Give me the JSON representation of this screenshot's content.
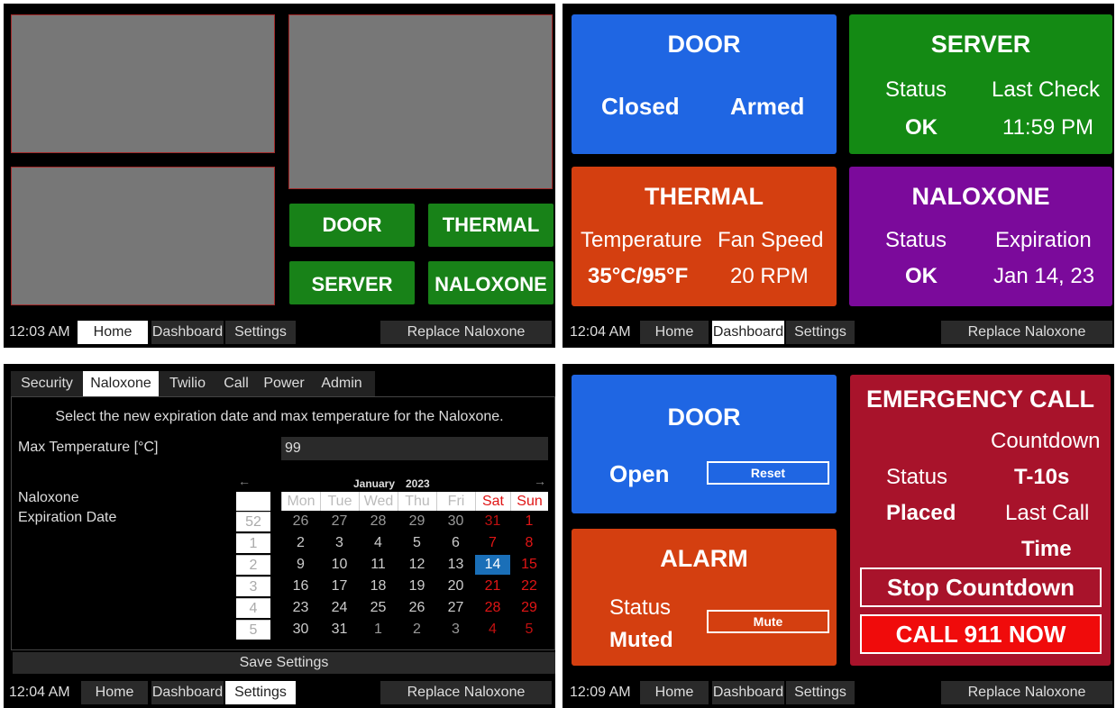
{
  "common": {
    "nav_home": "Home",
    "nav_dashboard": "Dashboard",
    "nav_settings": "Settings",
    "replace_naloxone": "Replace Naloxone"
  },
  "screens": {
    "home": {
      "time": "12:03 AM",
      "door_btn": "DOOR",
      "thermal_btn": "THERMAL",
      "server_btn": "SERVER",
      "naloxone_btn": "NALOXONE"
    },
    "dashboard": {
      "time": "12:04 AM",
      "door": {
        "title": "DOOR",
        "state": "Closed",
        "mode": "Armed"
      },
      "server": {
        "title": "SERVER",
        "status_label": "Status",
        "status_value": "OK",
        "check_label": "Last Check",
        "check_value": "11:59 PM"
      },
      "thermal": {
        "title": "THERMAL",
        "temp_label": "Temperature",
        "temp_value": "35°C/95°F",
        "fan_label": "Fan Speed",
        "fan_value": "20 RPM"
      },
      "naloxone": {
        "title": "NALOXONE",
        "status_label": "Status",
        "status_value": "OK",
        "exp_label": "Expiration",
        "exp_value": "Jan 14, 23"
      }
    },
    "settings": {
      "time": "12:04 AM",
      "tabs": [
        "Security",
        "Naloxone",
        "Twilio",
        "Call",
        "Power",
        "Admin"
      ],
      "instruction": "Select the new expiration date and max temperature for the Naloxone.",
      "max_temp_label": "Max Temperature [°C]",
      "max_temp_value": "99",
      "exp_label_line1": "Naloxone",
      "exp_label_line2": "Expiration Date",
      "calendar": {
        "prev": "←",
        "next": "→",
        "month": "January",
        "year": "2023",
        "weekdays": [
          "Mon",
          "Tue",
          "Wed",
          "Thu",
          "Fri",
          "Sat",
          "Sun"
        ],
        "weeks": [
          {
            "num": "52",
            "days": [
              "26",
              "27",
              "28",
              "29",
              "30",
              "31",
              "1"
            ]
          },
          {
            "num": "1",
            "days": [
              "2",
              "3",
              "4",
              "5",
              "6",
              "7",
              "8"
            ]
          },
          {
            "num": "2",
            "days": [
              "9",
              "10",
              "11",
              "12",
              "13",
              "14",
              "15"
            ]
          },
          {
            "num": "3",
            "days": [
              "16",
              "17",
              "18",
              "19",
              "20",
              "21",
              "22"
            ]
          },
          {
            "num": "4",
            "days": [
              "23",
              "24",
              "25",
              "26",
              "27",
              "28",
              "29"
            ]
          },
          {
            "num": "5",
            "days": [
              "30",
              "31",
              "1",
              "2",
              "3",
              "4",
              "5"
            ]
          }
        ],
        "selected_day": "14"
      },
      "save_button": "Save Settings"
    },
    "emergency": {
      "time": "12:09 AM",
      "door": {
        "title": "DOOR",
        "state": "Open",
        "reset_btn": "Reset"
      },
      "alarm": {
        "title": "ALARM",
        "status_label": "Status",
        "status_value": "Muted",
        "mute_btn": "Mute"
      },
      "call": {
        "title": "EMERGENCY CALL",
        "countdown_label": "Countdown",
        "status_label": "Status",
        "countdown_value": "T-10s",
        "status_value": "Placed",
        "last_call_label": "Last Call",
        "time_label": "Time",
        "stop_btn": "Stop Countdown",
        "call_btn": "CALL 911 NOW"
      }
    }
  },
  "colors": {
    "door": "#1f66e3",
    "server": "#148a14",
    "thermal": "#d43f10",
    "naloxone": "#7b0a9b",
    "emergency": "#a8132b",
    "call_button": "#f00b0b",
    "selected_day": "#1a6fb8",
    "weekend": "#e01515"
  }
}
